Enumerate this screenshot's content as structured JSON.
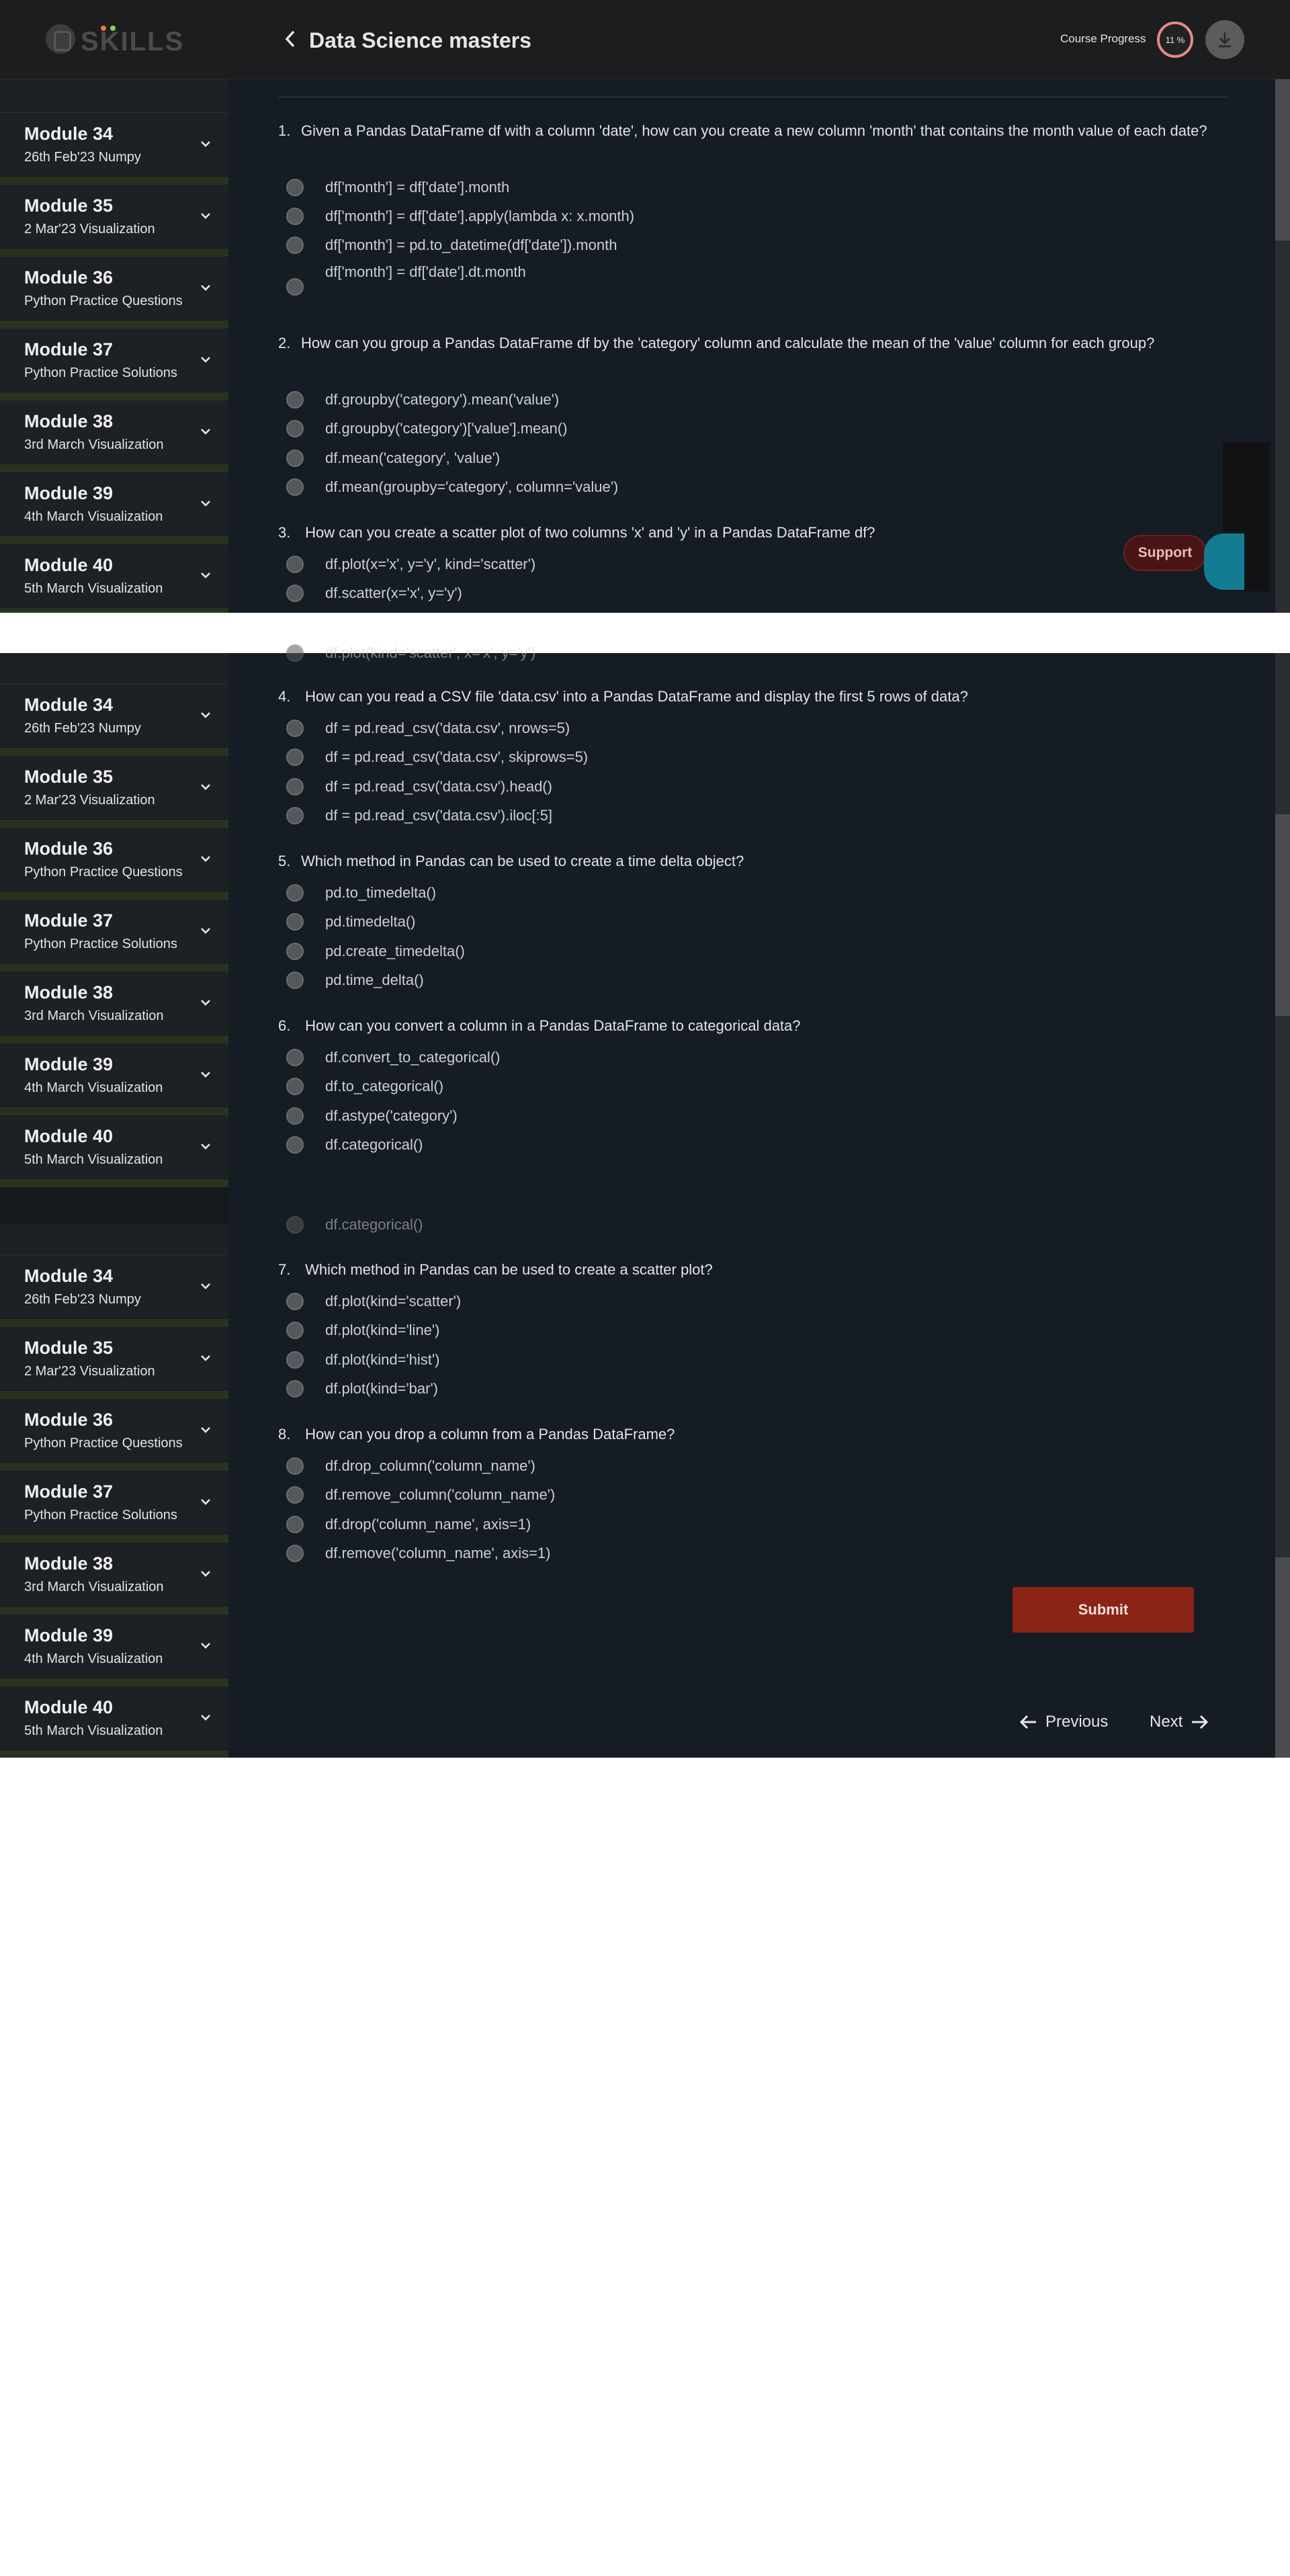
{
  "header": {
    "logo_text": "SKILLS",
    "title": "Data Science masters",
    "progress_label": "Course Progress",
    "progress_value": "11 %"
  },
  "sidebar": {
    "modules": [
      {
        "title": "Module 34",
        "subtitle": "26th Feb'23 Numpy"
      },
      {
        "title": "Module 35",
        "subtitle": "2 Mar'23 Visualization"
      },
      {
        "title": "Module 36",
        "subtitle": "Python Practice Questions"
      },
      {
        "title": "Module 37",
        "subtitle": "Python Practice Solutions"
      },
      {
        "title": "Module 38",
        "subtitle": "3rd March Visualization"
      },
      {
        "title": "Module 39",
        "subtitle": "4th March Visualization"
      },
      {
        "title": "Module 40",
        "subtitle": "5th March Visualization"
      }
    ]
  },
  "questions": [
    {
      "num": "1.",
      "text": "Given a Pandas DataFrame df with a column 'date', how can you create a new column 'month' that contains the month value of each date?",
      "options": [
        "df['month'] = df['date'].month",
        "df['month'] = df['date'].apply(lambda x: x.month)",
        " df['month'] = pd.to_datetime(df['date']).month",
        "df['month'] = df['date'].dt.month"
      ]
    },
    {
      "num": "2.",
      "text": "How can you group a Pandas DataFrame df by the 'category' column and calculate the mean of the 'value' column for each group?",
      "options": [
        " df.groupby('category').mean('value')",
        "df.groupby('category')['value'].mean()",
        " df.mean('category', 'value')",
        " df.mean(groupby='category', column='value')"
      ]
    },
    {
      "num": "3.",
      "text": " How can you create a scatter plot of two columns 'x' and 'y' in a Pandas DataFrame df?",
      "options": [
        " df.plot(x='x', y='y', kind='scatter')",
        "df.scatter(x='x', y='y')",
        "df.plot(kind='scatter', x='x', y='y')"
      ]
    },
    {
      "num": "4.",
      "text": " How can you read a CSV file 'data.csv' into a Pandas DataFrame and display the first 5 rows of data?",
      "options": [
        "df = pd.read_csv('data.csv', nrows=5)",
        "df = pd.read_csv('data.csv', skiprows=5)",
        "df = pd.read_csv('data.csv').head()",
        "df = pd.read_csv('data.csv').iloc[:5]"
      ]
    },
    {
      "num": "5.",
      "text": "Which method in Pandas can be used to create a time delta object?",
      "options": [
        "pd.to_timedelta()",
        " pd.timedelta()",
        "pd.create_timedelta()",
        "pd.time_delta()"
      ]
    },
    {
      "num": "6.",
      "text": " How can you convert a column in a Pandas DataFrame to categorical data?",
      "options": [
        " df.convert_to_categorical()",
        "df.to_categorical()",
        "df.astype('category')",
        "df.categorical()"
      ]
    },
    {
      "num": "7.",
      "text": " Which method in Pandas can be used to create a scatter plot?",
      "options": [
        "df.plot(kind='scatter')",
        "df.plot(kind='line')",
        "df.plot(kind='hist')",
        "df.plot(kind='bar')"
      ]
    },
    {
      "num": "8.",
      "text": " How can you drop a column from a Pandas DataFrame?",
      "options": [
        "df.drop_column('column_name')",
        "df.remove_column('column_name')",
        "df.drop('column_name', axis=1)",
        " df.remove('column_name', axis=1)"
      ]
    }
  ],
  "actions": {
    "support_label": "Support",
    "submit_label": "Submit",
    "previous_label": "Previous",
    "next_label": "Next"
  },
  "colors": {
    "background": "#151c23",
    "sidebar": "#1d2024",
    "submit": "#8a2417",
    "support": "#4a1414",
    "progress_ring": "#e58a8a"
  }
}
